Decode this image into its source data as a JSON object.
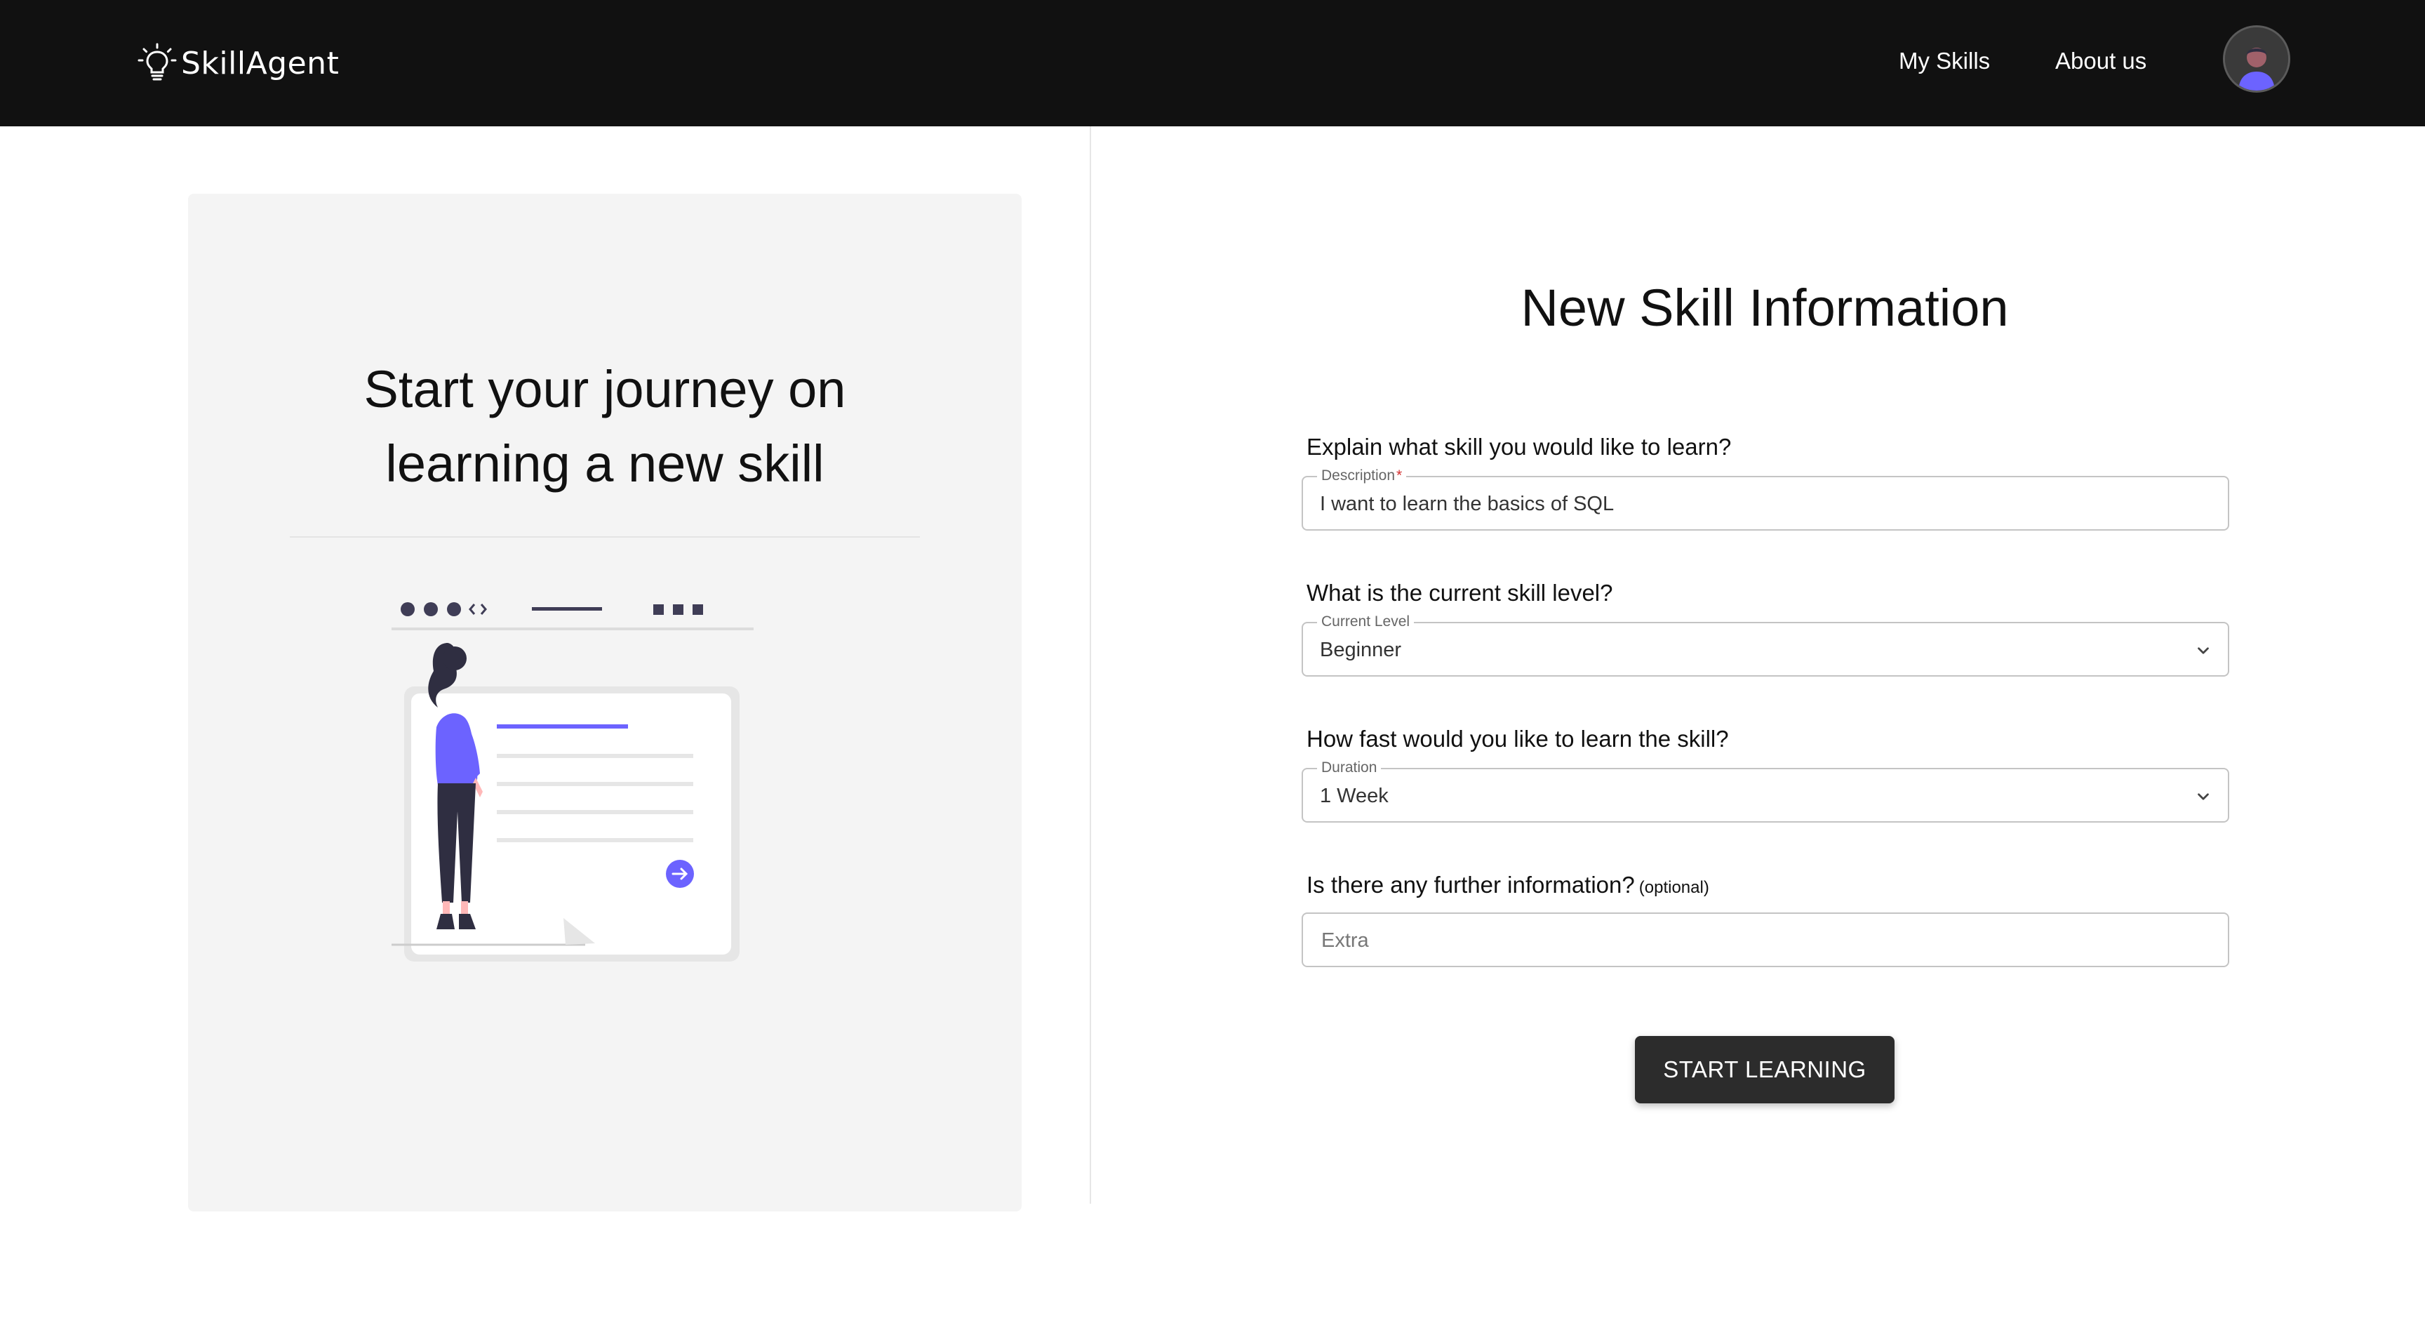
{
  "header": {
    "brand": "SkillAgent",
    "nav": {
      "my_skills": "My Skills",
      "about_us": "About us"
    }
  },
  "hero": {
    "title_line1": "Start your journey on",
    "title_line2": "learning a new skill"
  },
  "form": {
    "title": "New Skill Information",
    "description": {
      "question": "Explain what skill you would like to learn?",
      "legend": "Description",
      "required_mark": "*",
      "value": "I want to learn the basics of SQL"
    },
    "level": {
      "question": "What is the current skill level?",
      "legend": "Current Level",
      "value": "Beginner"
    },
    "duration": {
      "question": "How fast would you like to learn the skill?",
      "legend": "Duration",
      "value": "1 Week"
    },
    "extra": {
      "question": "Is there any further information?",
      "optional_note": "(optional)",
      "placeholder": "Extra"
    },
    "submit_label": "START LEARNING"
  },
  "colors": {
    "topbar": "#111111",
    "accent_purple": "#6c63ff",
    "button": "#2c2c2c",
    "card_bg": "#f4f4f4"
  },
  "icons": {
    "logo": "lightbulb-icon",
    "avatar": "user-avatar",
    "select": "chevron-down-icon"
  }
}
